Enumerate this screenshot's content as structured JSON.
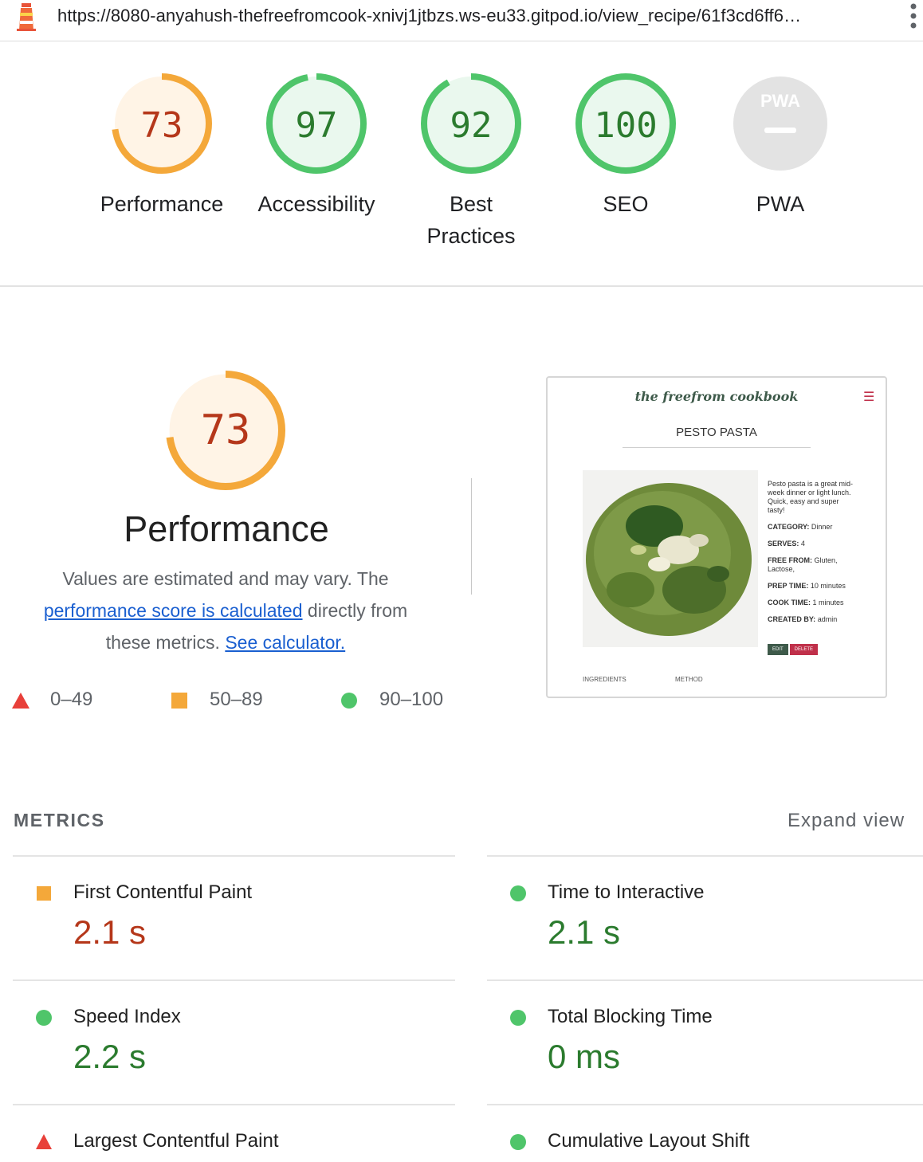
{
  "browser": {
    "url": "https://8080-anyahush-thefreefromcook-xnivj1jtbzs.ws-eu33.gitpod.io/view_recipe/61f3cd6ff6…",
    "logo_icon": "lighthouse-icon",
    "menu_icon": "more-vert-icon"
  },
  "gauges": [
    {
      "score": "73",
      "label": "Performance",
      "progress": 0.73,
      "color": "#f4a83a",
      "fill": "#fff4e6",
      "text_color": "#b5371a"
    },
    {
      "score": "97",
      "label": "Accessibility",
      "progress": 0.97,
      "color": "#4fc56a",
      "fill": "#eaf8ee",
      "text_color": "#2b7b2e"
    },
    {
      "score": "92",
      "label": "Best Practices",
      "progress": 0.92,
      "color": "#4fc56a",
      "fill": "#eaf8ee",
      "text_color": "#2b7b2e"
    },
    {
      "score": "100",
      "label": "SEO",
      "progress": 1.0,
      "color": "#4fc56a",
      "fill": "#eaf8ee",
      "text_color": "#2b7b2e"
    },
    {
      "score": "PWA",
      "label": "PWA",
      "progress": 0,
      "color": "#e3e3e3",
      "fill": "#e3e3e3",
      "text_color": "#9e9e9e"
    }
  ],
  "performance": {
    "score": "73",
    "progress": 0.73,
    "title": "Performance",
    "desc_part1": "Values are estimated and may vary. The ",
    "desc_link1": "performance score is calculated",
    "desc_part2": " directly from these metrics. ",
    "desc_link2": "See calculator.",
    "legend": [
      {
        "shape": "triangle",
        "range": "0–49",
        "color": "#e8403a"
      },
      {
        "shape": "square",
        "range": "50–89",
        "color": "#f4a83a"
      },
      {
        "shape": "circle",
        "range": "90–100",
        "color": "#4fc56a"
      }
    ]
  },
  "thumbnail": {
    "brand": "the freefrom cookbook",
    "menu_icon": "hamburger-icon",
    "recipe_title": "PESTO PASTA",
    "description": "Pesto pasta is a great mid-week dinner or light lunch. Quick, easy and super tasty!",
    "category_label": "CATEGORY:",
    "category": "Dinner",
    "serves_label": "SERVES:",
    "serves": "4",
    "freefrom_label": "FREE FROM:",
    "freefrom": "Gluten, Lactose,",
    "prep_label": "PREP TIME:",
    "prep": "10 minutes",
    "cook_label": "COOK TIME:",
    "cook": "1 minutes",
    "created_label": "CREATED BY:",
    "created": "admin",
    "edit_btn": "EDIT",
    "delete_btn": "DELETE",
    "ingredients_label": "INGREDIENTS",
    "method_label": "METHOD"
  },
  "metrics": {
    "heading": "METRICS",
    "expand": "Expand view",
    "items": [
      {
        "label": "First Contentful Paint",
        "value": "2.1 s",
        "status": "average"
      },
      {
        "label": "Time to Interactive",
        "value": "2.1 s",
        "status": "pass"
      },
      {
        "label": "Speed Index",
        "value": "2.2 s",
        "status": "pass"
      },
      {
        "label": "Total Blocking Time",
        "value": "0 ms",
        "status": "pass"
      },
      {
        "label": "Largest Contentful Paint",
        "value": "",
        "status": "fail"
      },
      {
        "label": "Cumulative Layout Shift",
        "value": "",
        "status": "pass"
      }
    ],
    "status_colors": {
      "fail": "#e8403a",
      "average": "#f4a83a",
      "pass": "#4fc56a"
    },
    "value_colors": {
      "fail": "#c5221f",
      "average": "#b5371a",
      "pass": "#2b7b2e"
    }
  }
}
